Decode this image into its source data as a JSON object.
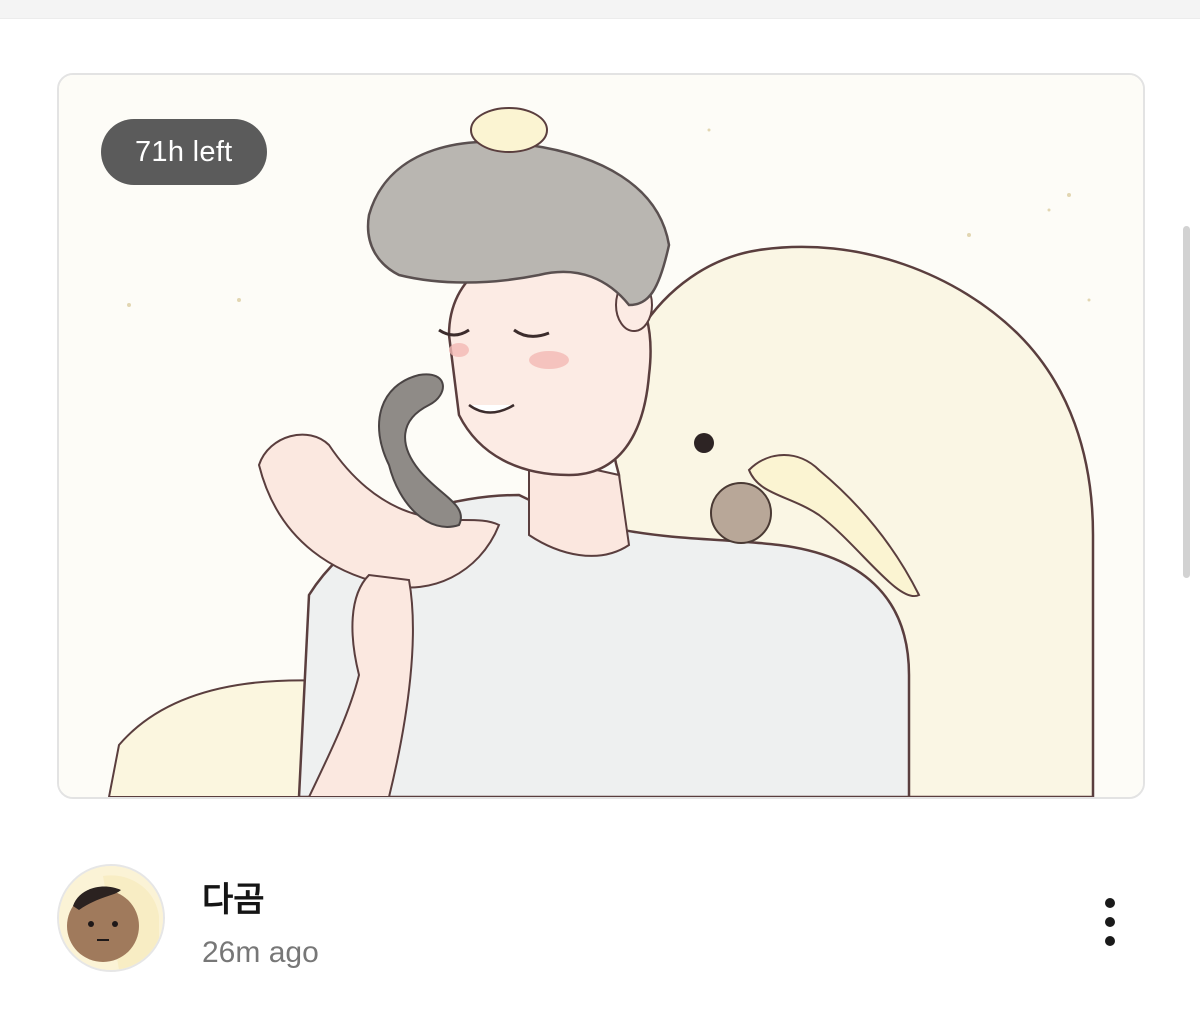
{
  "post": {
    "timer_label": "71h left",
    "image_icon": "illustration-artwork",
    "author": {
      "name": "다곰",
      "avatar_icon": "avatar-illustration"
    },
    "time_ago": "26m ago",
    "more_icon": "more-vertical-icon"
  },
  "colors": {
    "badge_background": "#5b5b5b",
    "card_border": "#e3e3e3",
    "secondary_text": "#777777"
  }
}
